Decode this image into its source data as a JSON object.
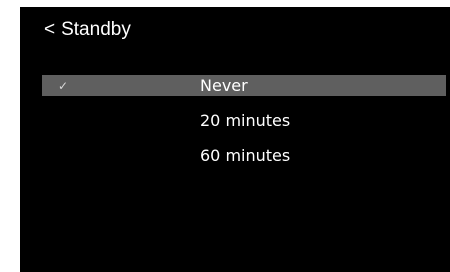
{
  "header": {
    "back_glyph": "<",
    "title": "Standby"
  },
  "options": [
    {
      "label": "Never",
      "selected": true,
      "check_glyph": "✓"
    },
    {
      "label": "20 minutes",
      "selected": false
    },
    {
      "label": "60 minutes",
      "selected": false
    }
  ],
  "colors": {
    "background": "#000000",
    "text": "#ffffff",
    "selection_highlight": "#5f5f5f",
    "check": "#d8d8d8"
  }
}
